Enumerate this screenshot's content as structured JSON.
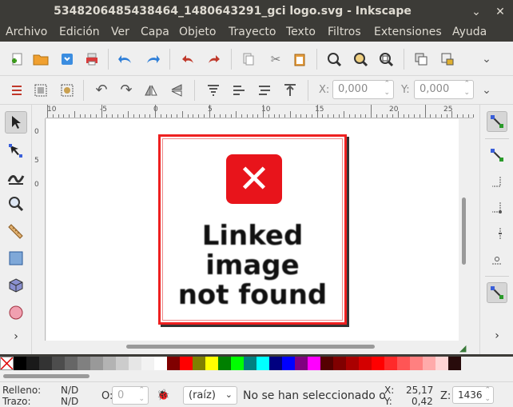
{
  "window": {
    "title": "5348206485438464_1480643291_gci logo.svg - Inkscape",
    "minimize_glyph": "⌄",
    "close_glyph": "✕"
  },
  "menu": [
    "Archivo",
    "Edición",
    "Ver",
    "Capa",
    "Objeto",
    "Trayecto",
    "Texto",
    "Filtros",
    "Extensiones",
    "Ayuda"
  ],
  "commands_toolbar": {
    "icons": [
      "new-document-icon",
      "open-folder-icon",
      "save-icon",
      "print-icon",
      "undo-icon",
      "redo-icon",
      "revert-icon",
      "redo-alt-icon",
      "copy-icon",
      "cut-icon",
      "paste-icon",
      "zoom-selection-icon",
      "zoom-drawing-icon",
      "zoom-page-icon",
      "duplicate-icon",
      "lock-icon"
    ]
  },
  "controls_toolbar": {
    "x_label": "X:",
    "x_value": "0,000",
    "y_label": "Y:",
    "y_value": "0,000"
  },
  "ruler": {
    "h_labels": [
      "10",
      "-5",
      "0",
      "5",
      "10",
      "15",
      "20",
      "25"
    ],
    "v_labels": [
      "0",
      "5",
      "0"
    ]
  },
  "canvas": {
    "linked_image_text": "Linked\nimage\nnot found",
    "x_mark": "✕"
  },
  "palette": {
    "colors": [
      "#000000",
      "#1a1a1a",
      "#333333",
      "#4d4d4d",
      "#666666",
      "#808080",
      "#999999",
      "#b3b3b3",
      "#cccccc",
      "#e6e6e6",
      "#f2f2f2",
      "#ffffff",
      "#800000",
      "#ff0000",
      "#808000",
      "#ffff00",
      "#008000",
      "#00ff00",
      "#008080",
      "#00ffff",
      "#000080",
      "#0000ff",
      "#800080",
      "#ff00ff",
      "#550000",
      "#800000",
      "#aa0000",
      "#d40000",
      "#ff0000",
      "#ff2a2a",
      "#ff5555",
      "#ff8080",
      "#ffaaaa",
      "#ffd5d5",
      "#280b0b"
    ]
  },
  "status": {
    "fill_label": "Relleno:",
    "fill_value": "N/D",
    "stroke_label": "Trazo:",
    "stroke_value": "N/D",
    "opacity_label": "O:",
    "opacity_value": "0",
    "layer_value": "(raíz)",
    "message": "No se han seleccionado o",
    "x_label": "X:",
    "x_value": "25,17",
    "y_label": "Y:",
    "y_value": "0,42",
    "zoom_label": "Z:",
    "zoom_value": "1436"
  }
}
